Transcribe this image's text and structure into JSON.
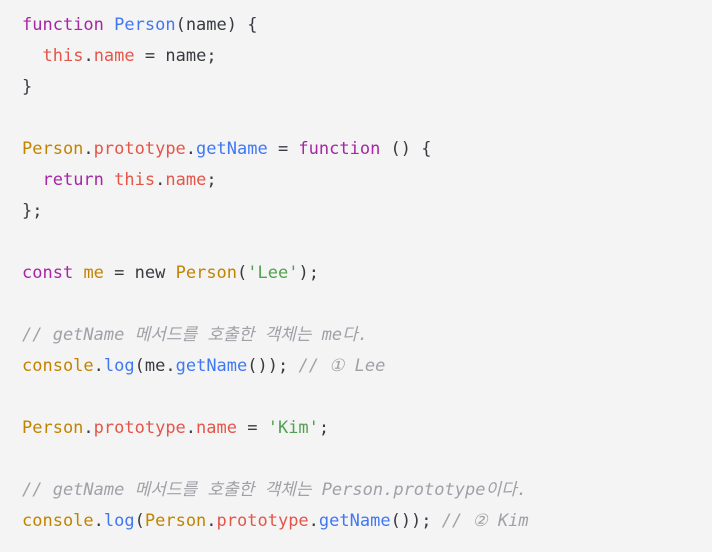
{
  "editor": {
    "language": "javascript",
    "background_color": "#f4f4f4",
    "default_text_color": "#383a42",
    "theme_colors": {
      "keyword": "#a626a4",
      "function": "#4078f2",
      "class": "#c18401",
      "property": "#e45649",
      "string": "#50a14f",
      "comment": "#a0a1a7",
      "plain": "#383a42"
    }
  },
  "lines": [
    {
      "id": "line-1",
      "tokens": [
        {
          "t": "function",
          "c": "keyword"
        },
        {
          "t": " ",
          "c": "plain"
        },
        {
          "t": "Person",
          "c": "function"
        },
        {
          "t": "(",
          "c": "punct"
        },
        {
          "t": "name",
          "c": "plain"
        },
        {
          "t": ") {",
          "c": "punct"
        }
      ]
    },
    {
      "id": "line-2",
      "tokens": [
        {
          "t": "  ",
          "c": "plain"
        },
        {
          "t": "this",
          "c": "property"
        },
        {
          "t": ".",
          "c": "punct"
        },
        {
          "t": "name",
          "c": "property"
        },
        {
          "t": " = ",
          "c": "operator"
        },
        {
          "t": "name",
          "c": "plain"
        },
        {
          "t": ";",
          "c": "punct"
        }
      ]
    },
    {
      "id": "line-3",
      "tokens": [
        {
          "t": "}",
          "c": "punct"
        }
      ]
    },
    {
      "id": "line-4",
      "tokens": []
    },
    {
      "id": "line-5",
      "tokens": [
        {
          "t": "Person",
          "c": "class"
        },
        {
          "t": ".",
          "c": "punct"
        },
        {
          "t": "prototype",
          "c": "property"
        },
        {
          "t": ".",
          "c": "punct"
        },
        {
          "t": "getName",
          "c": "function"
        },
        {
          "t": " = ",
          "c": "operator"
        },
        {
          "t": "function",
          "c": "keyword"
        },
        {
          "t": " () {",
          "c": "punct"
        }
      ]
    },
    {
      "id": "line-6",
      "tokens": [
        {
          "t": "  ",
          "c": "plain"
        },
        {
          "t": "return",
          "c": "keyword"
        },
        {
          "t": " ",
          "c": "plain"
        },
        {
          "t": "this",
          "c": "property"
        },
        {
          "t": ".",
          "c": "punct"
        },
        {
          "t": "name",
          "c": "property"
        },
        {
          "t": ";",
          "c": "punct"
        }
      ]
    },
    {
      "id": "line-7",
      "tokens": [
        {
          "t": "};",
          "c": "punct"
        }
      ]
    },
    {
      "id": "line-8",
      "tokens": []
    },
    {
      "id": "line-9",
      "tokens": [
        {
          "t": "const",
          "c": "keyword"
        },
        {
          "t": " ",
          "c": "plain"
        },
        {
          "t": "me",
          "c": "class"
        },
        {
          "t": " = ",
          "c": "operator"
        },
        {
          "t": "new",
          "c": "plain"
        },
        {
          "t": " ",
          "c": "plain"
        },
        {
          "t": "Person",
          "c": "class"
        },
        {
          "t": "(",
          "c": "punct"
        },
        {
          "t": "'Lee'",
          "c": "string"
        },
        {
          "t": ");",
          "c": "punct"
        }
      ]
    },
    {
      "id": "line-10",
      "tokens": []
    },
    {
      "id": "line-11",
      "tokens": [
        {
          "t": "// getName 메서드를 호출한 객체는 me다.",
          "c": "comment"
        }
      ]
    },
    {
      "id": "line-12",
      "tokens": [
        {
          "t": "console",
          "c": "class"
        },
        {
          "t": ".",
          "c": "punct"
        },
        {
          "t": "log",
          "c": "function"
        },
        {
          "t": "(",
          "c": "punct"
        },
        {
          "t": "me",
          "c": "plain"
        },
        {
          "t": ".",
          "c": "punct"
        },
        {
          "t": "getName",
          "c": "function"
        },
        {
          "t": "()); ",
          "c": "punct"
        },
        {
          "t": "// ① Lee",
          "c": "comment"
        }
      ]
    },
    {
      "id": "line-13",
      "tokens": []
    },
    {
      "id": "line-14",
      "tokens": [
        {
          "t": "Person",
          "c": "class"
        },
        {
          "t": ".",
          "c": "punct"
        },
        {
          "t": "prototype",
          "c": "property"
        },
        {
          "t": ".",
          "c": "punct"
        },
        {
          "t": "name",
          "c": "property"
        },
        {
          "t": " = ",
          "c": "operator"
        },
        {
          "t": "'Kim'",
          "c": "string"
        },
        {
          "t": ";",
          "c": "punct"
        }
      ]
    },
    {
      "id": "line-15",
      "tokens": []
    },
    {
      "id": "line-16",
      "tokens": [
        {
          "t": "// getName 메서드를 호출한 객체는 Person.prototype이다.",
          "c": "comment"
        }
      ]
    },
    {
      "id": "line-17",
      "tokens": [
        {
          "t": "console",
          "c": "class"
        },
        {
          "t": ".",
          "c": "punct"
        },
        {
          "t": "log",
          "c": "function"
        },
        {
          "t": "(",
          "c": "punct"
        },
        {
          "t": "Person",
          "c": "class"
        },
        {
          "t": ".",
          "c": "punct"
        },
        {
          "t": "prototype",
          "c": "property"
        },
        {
          "t": ".",
          "c": "punct"
        },
        {
          "t": "getName",
          "c": "function"
        },
        {
          "t": "()); ",
          "c": "punct"
        },
        {
          "t": "// ② Kim",
          "c": "comment"
        }
      ]
    }
  ]
}
